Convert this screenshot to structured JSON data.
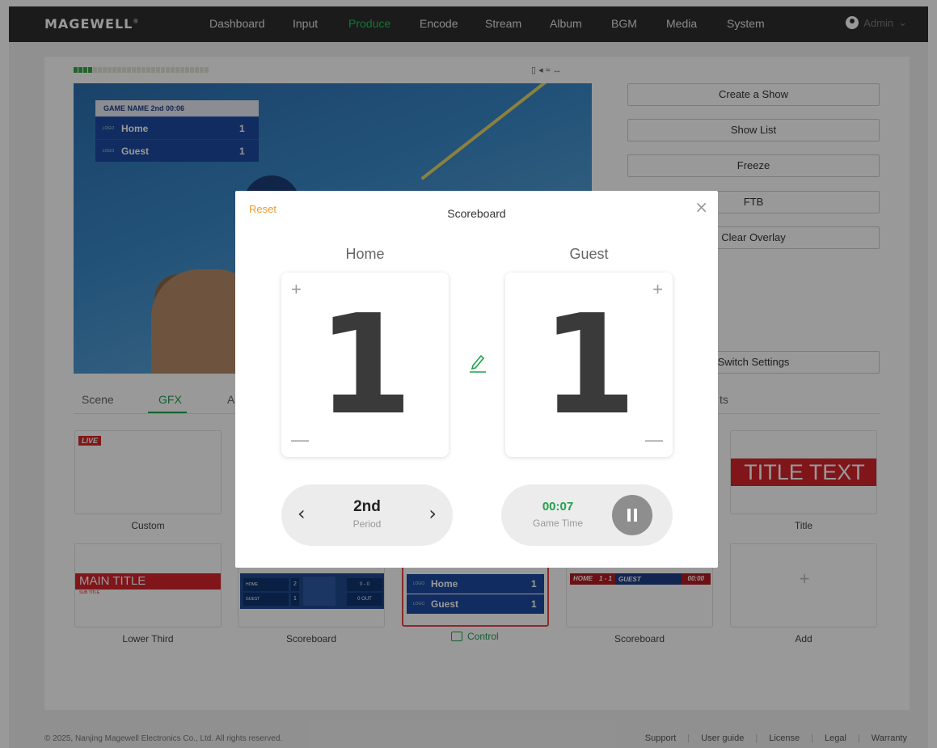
{
  "app": {
    "logo": "MAGEWELL",
    "user": "Admin"
  },
  "nav": [
    "Dashboard",
    "Input",
    "Produce",
    "Encode",
    "Stream",
    "Album",
    "BGM",
    "Media",
    "System"
  ],
  "nav_active": "Produce",
  "preview": {
    "scoreboard": {
      "header": "GAME NAME  2nd  00:06",
      "logo": "LOGO",
      "home": "Home",
      "home_score": "1",
      "guest": "Guest",
      "guest_score": "1"
    }
  },
  "actions": {
    "create_show": "Create a Show",
    "show_list": "Show List",
    "freeze": "Freeze",
    "ftb": "FTB",
    "clear_overlay": "Clear Overlay",
    "switch_settings": "Switch Settings"
  },
  "tabs": {
    "scene": "Scene",
    "gfx": "GFX",
    "a_partial": "A",
    "ts_partial": "ts"
  },
  "gfx_cards": {
    "custom": {
      "label": "Custom",
      "badge": "LIVE"
    },
    "title": {
      "label": "Title",
      "text": "TITLE TEXT"
    },
    "lower_third": {
      "label": "Lower Third",
      "main": "MAIN TITLE",
      "sub": "SUB TITLE"
    },
    "scoreboard1": {
      "label": "Scoreboard",
      "home": "HOME",
      "guest": "GUEST",
      "home_n": "2",
      "guest_n": "1",
      "count": "0 - 0",
      "outs": "0 OUT"
    },
    "scoreboard2": {
      "control_label": "Control",
      "logo": "LOGO",
      "home": "Home",
      "home_score": "1",
      "guest": "Guest",
      "guest_score": "1"
    },
    "scoreboard3": {
      "label": "Scoreboard",
      "home": "HOME",
      "score": "1 - 1",
      "guest": "GUEST",
      "time": "00:00"
    },
    "add": {
      "label": "Add",
      "plus": "+"
    }
  },
  "modal": {
    "title": "Scoreboard",
    "reset": "Reset",
    "close": "×",
    "home": {
      "name": "Home",
      "score": "1"
    },
    "guest": {
      "name": "Guest",
      "score": "1"
    },
    "period": {
      "value": "2nd",
      "label": "Period"
    },
    "game_time": {
      "value": "00:07",
      "label": "Game Time"
    }
  },
  "footer": {
    "copyright": "© 2025, Nanjing Magewell Electronics Co., Ltd. All rights reserved.",
    "links": [
      "Support",
      "User guide",
      "License",
      "Legal",
      "Warranty"
    ]
  },
  "colors": {
    "accent_green": "#21a24f",
    "reset_orange": "#f39a28",
    "brand_red": "#d6232c",
    "score_blue": "#1c4aa0"
  }
}
